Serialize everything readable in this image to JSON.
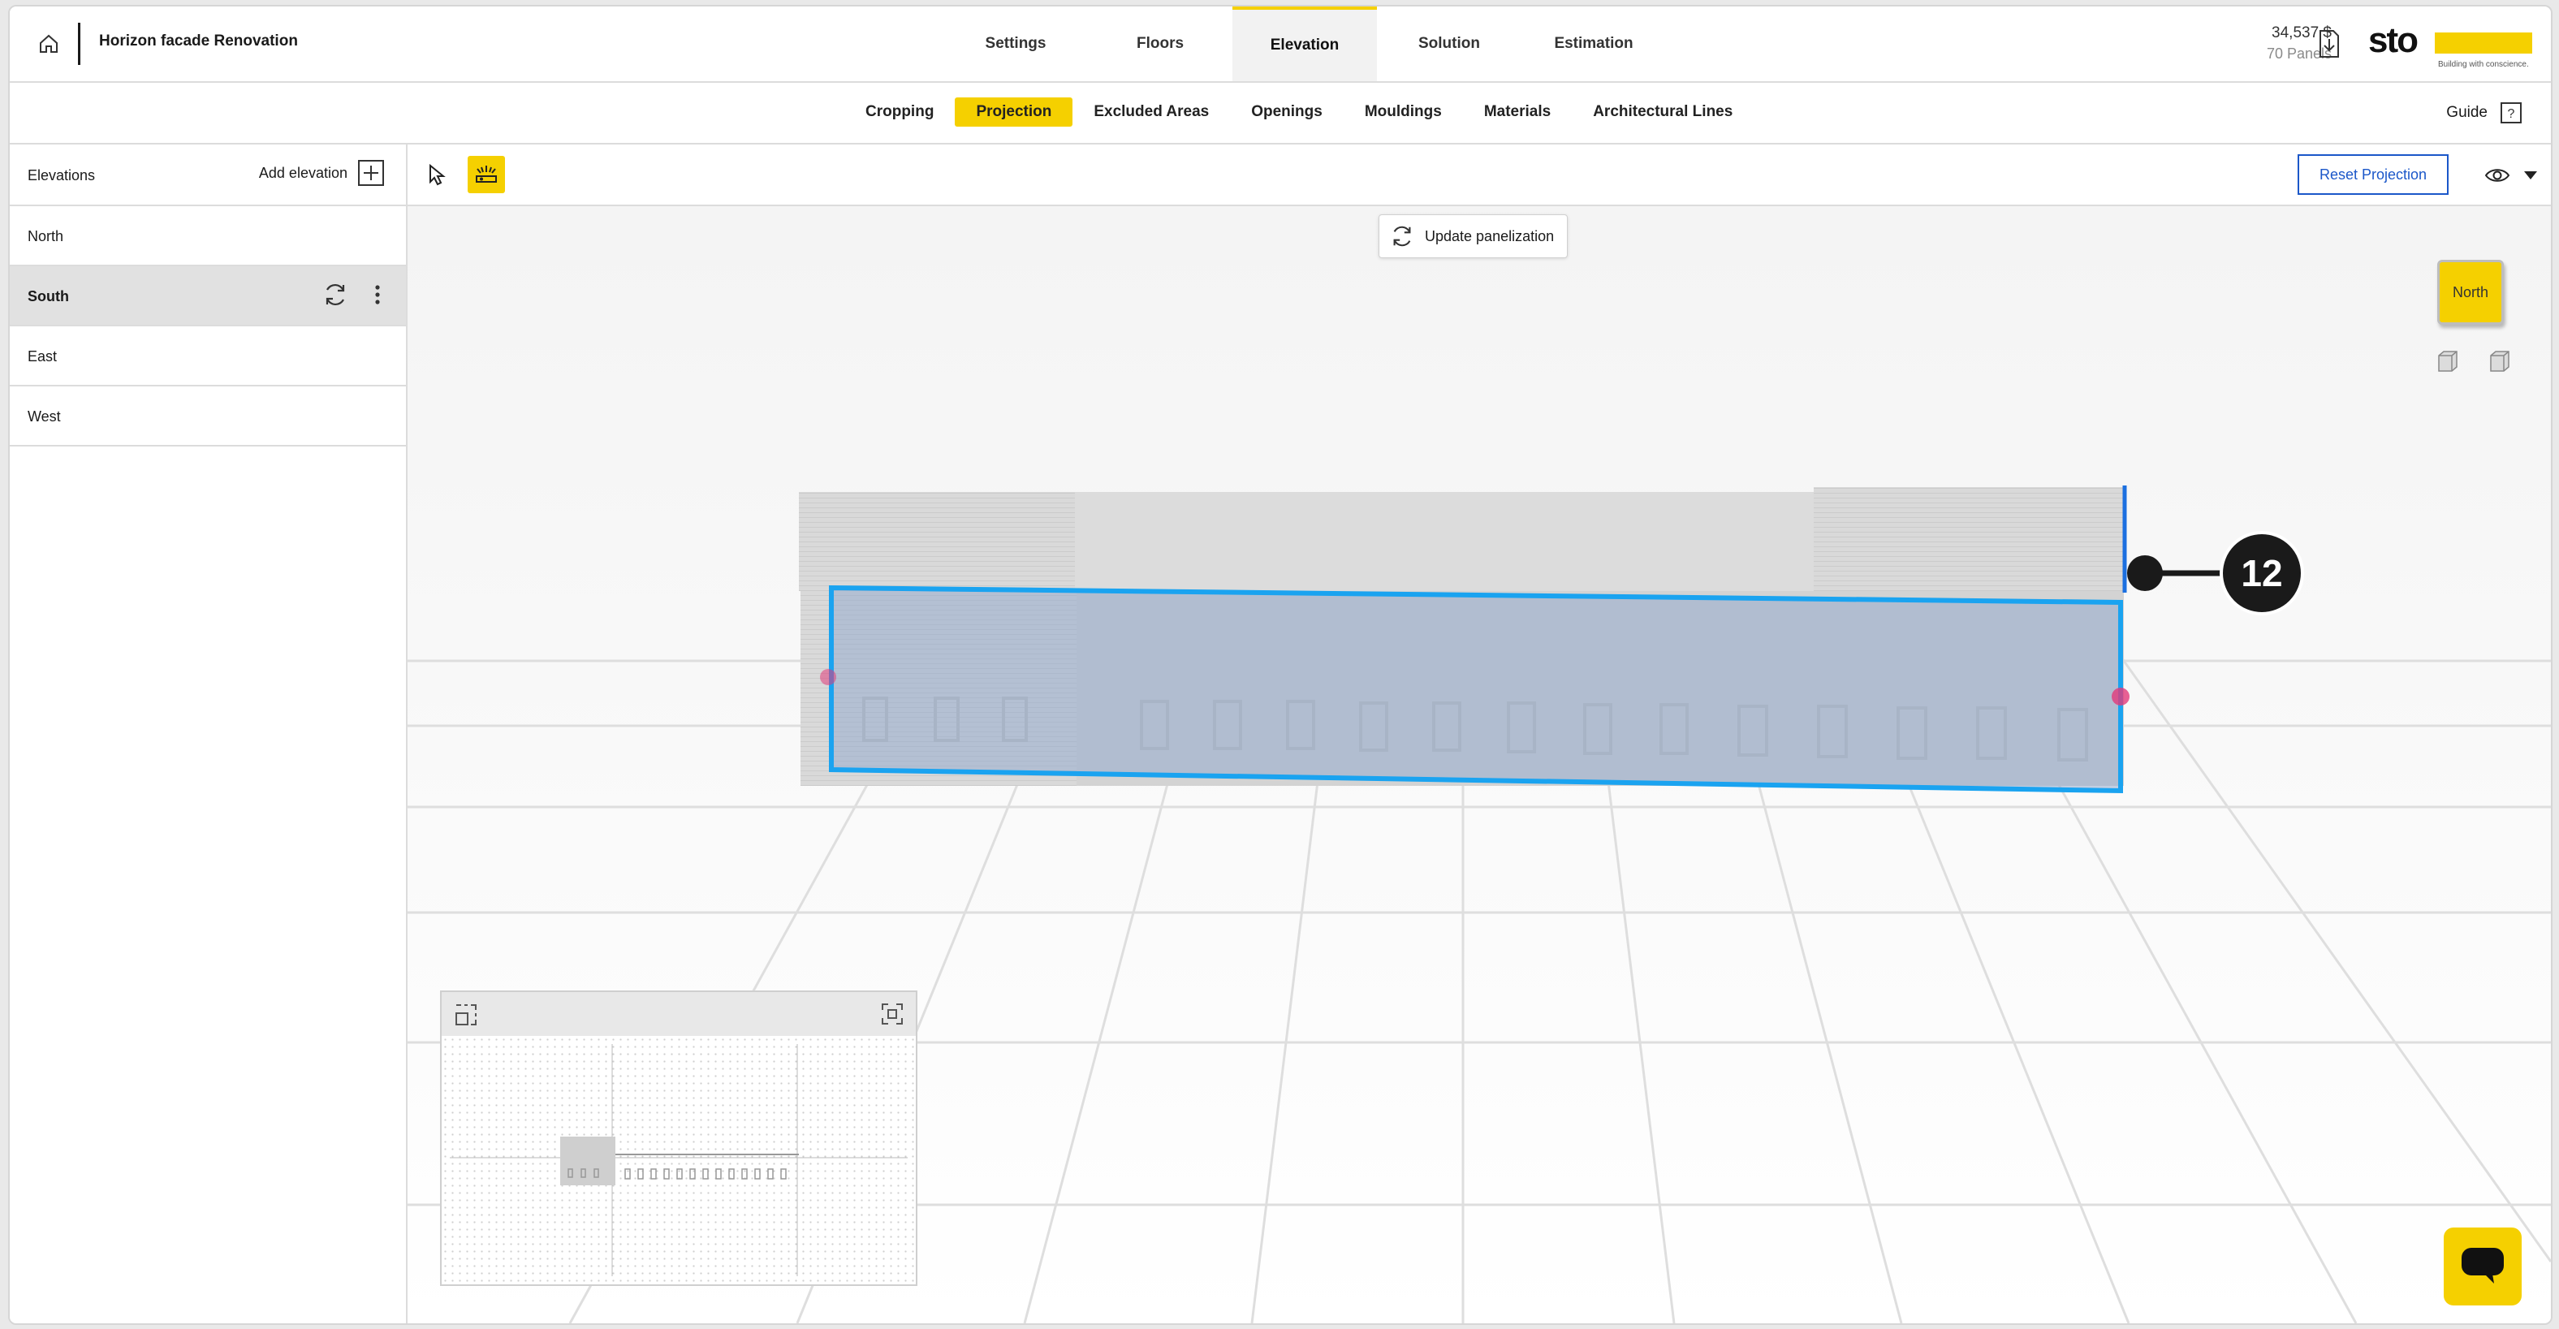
{
  "header": {
    "project_title": "Horizon facade Renovation",
    "tabs": [
      "Settings",
      "Floors",
      "Elevation",
      "Solution",
      "Estimation"
    ],
    "active_tab": "Elevation",
    "price": "34,537 $",
    "panels": "70 Panels",
    "logo": {
      "word": "sto",
      "tagline": "Building with conscience."
    }
  },
  "subnav": {
    "tabs": [
      "Cropping",
      "Projection",
      "Excluded Areas",
      "Openings",
      "Mouldings",
      "Materials",
      "Architectural Lines"
    ],
    "active_tab": "Projection",
    "guide_label": "Guide"
  },
  "sidebar": {
    "title": "Elevations",
    "add_label": "Add elevation",
    "items": [
      "North",
      "South",
      "East",
      "West"
    ],
    "active_item": "South"
  },
  "toolbar": {
    "reset_label": "Reset Projection"
  },
  "viewport": {
    "update_label": "Update panelization",
    "viewcube_label": "North",
    "annotation_badge": "12"
  },
  "colors": {
    "accent": "#f5d000",
    "selection": "#1aa3f0",
    "button_blue": "#1b57c9"
  }
}
